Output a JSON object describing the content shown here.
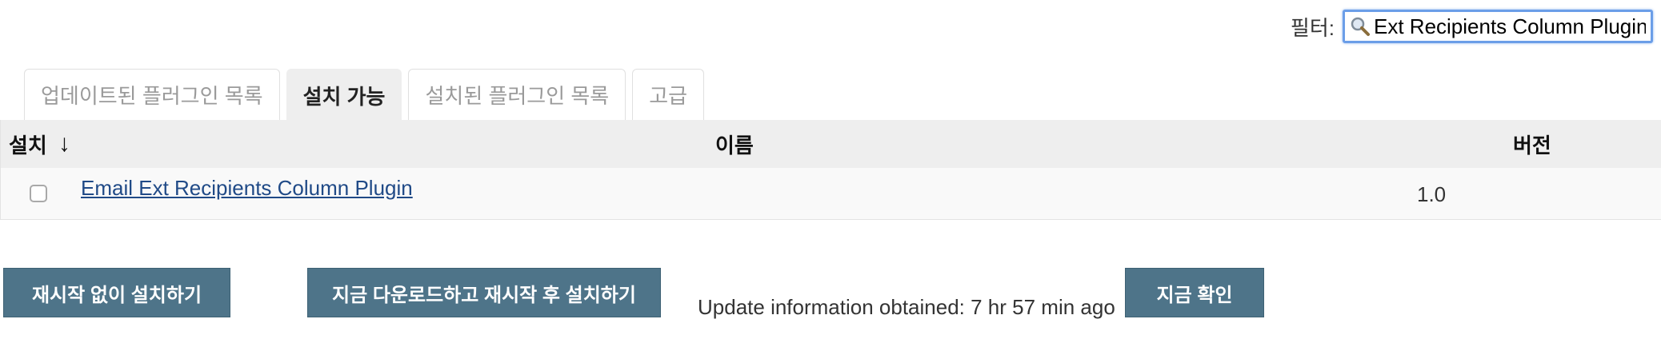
{
  "filter": {
    "label": "필터:",
    "value": "Ext Recipients Column Plugin",
    "icon": "search-icon"
  },
  "tabs": [
    {
      "label": "업데이트된 플러그인 목록",
      "active": false
    },
    {
      "label": "설치 가능",
      "active": true
    },
    {
      "label": "설치된 플러그인 목록",
      "active": false
    },
    {
      "label": "고급",
      "active": false
    }
  ],
  "table": {
    "headers": {
      "install": "설치",
      "sort_arrow": "↓",
      "name": "이름",
      "version": "버전"
    },
    "rows": [
      {
        "checked": false,
        "name": "Email Ext Recipients Column Plugin",
        "version": "1.0"
      }
    ]
  },
  "buttons": {
    "install_without_restart": "재시작 없이 설치하기",
    "download_and_install_after_restart": "지금 다운로드하고 재시작 후 설치하기",
    "check_now": "지금 확인"
  },
  "update_info": "Update information obtained: 7 hr 57 min ago",
  "colors": {
    "button_bg": "#4e7489",
    "link": "#204a87",
    "filter_border": "#6b9ee8",
    "header_bg": "#eeeeee"
  }
}
